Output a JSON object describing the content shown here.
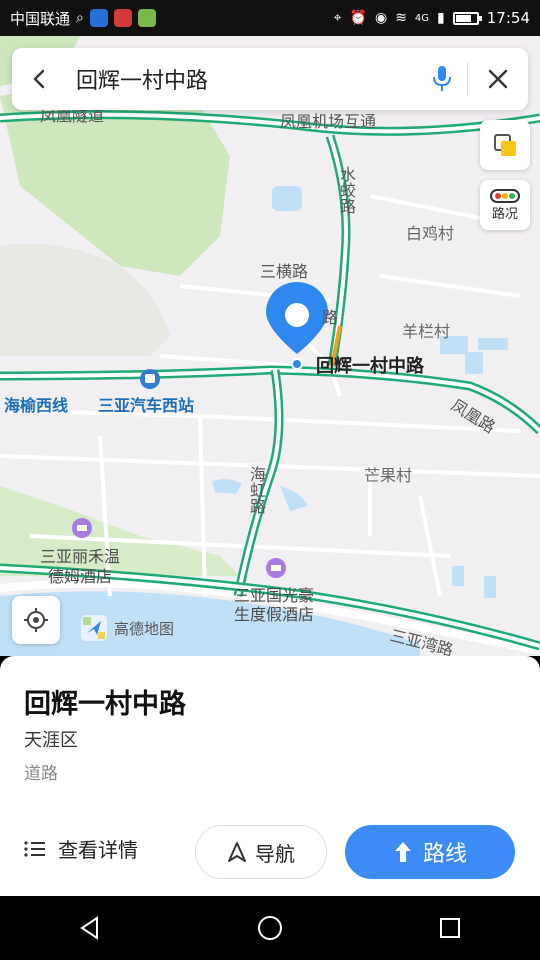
{
  "status_bar": {
    "carrier": "中国联通",
    "network": "4G",
    "time": "17:54"
  },
  "search": {
    "query": "回辉一村中路"
  },
  "map_controls": {
    "layers_icon": "layers-icon",
    "traffic_label": "路况"
  },
  "map_labels": {
    "fenghuang_tunnel": "凤凰隧道",
    "airport_road": "凤凰机场互通",
    "shuijiao_road": "水蛟路",
    "baiji_village": "白鸡村",
    "sanheng_road": "三横路",
    "road_fragment": "路",
    "yanglan_village": "羊栏村",
    "poi_name": "回辉一村中路",
    "haiyu_west": "海榆西线",
    "bus_station": "三亚汽车西站",
    "fenghuang_road": "凤凰路",
    "mangguo_village": "芒果村",
    "haihong_road": "海虹路",
    "hotel1_line1": "三亚丽禾温",
    "hotel1_line2": "德姆酒店",
    "hotel2_line1": "三亚国光豪",
    "hotel2_line2": "生度假酒店",
    "sanya_bay_road": "三亚湾路"
  },
  "logo_text": "高德地图",
  "place": {
    "title": "回辉一村中路",
    "district": "天涯区",
    "category": "道路"
  },
  "actions": {
    "details_label": "查看详情",
    "navigate_label": "导航",
    "route_label": "路线"
  },
  "colors": {
    "accent": "#3d8bf5",
    "road": "#1faa74",
    "water": "#bfe0f7",
    "green": "#c9e6b8"
  }
}
